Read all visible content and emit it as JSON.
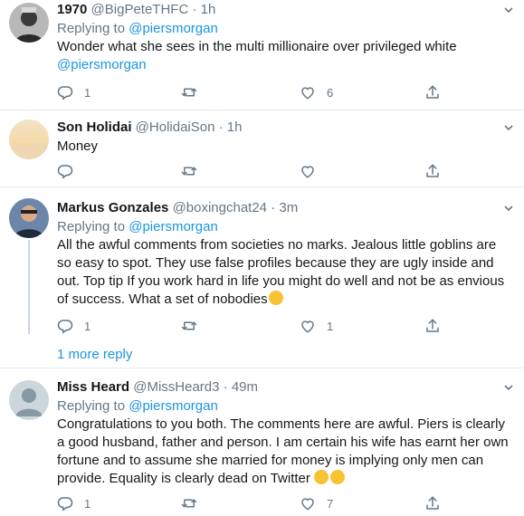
{
  "tweets": [
    {
      "name": "1970",
      "handle": "@BigPeteTHFC",
      "sep": "·",
      "time": "1h",
      "replying_prefix": "Replying to ",
      "replying_to": "@piersmorgan",
      "text": "Wonder what she sees in the multi millionaire over privileged white",
      "text_mention": "@piersmorgan",
      "reply_count": "1",
      "retweet_count": "",
      "like_count": "6"
    },
    {
      "name": "Son Holidai",
      "handle": "@HolidaiSon",
      "sep": "·",
      "time": "1h",
      "text": "Money",
      "reply_count": "",
      "retweet_count": "",
      "like_count": ""
    },
    {
      "name": "Markus Gonzales",
      "handle": "@boxingchat24",
      "sep": "·",
      "time": "3m",
      "replying_prefix": "Replying to ",
      "replying_to": "@piersmorgan",
      "text": "All the awful comments from societies no marks. Jealous little goblins are so easy to spot. They use false profiles because they are ugly inside and out. Top tip If you work hard in life you might do well and not be as envious of success. What a set of nobodies",
      "reply_count": "1",
      "retweet_count": "",
      "like_count": "1"
    },
    {
      "name": "Miss Heard",
      "handle": "@MissHeard3",
      "sep": "·",
      "time": "49m",
      "replying_prefix": "Replying to ",
      "replying_to": "@piersmorgan",
      "text": "Congratulations to you both. The comments here are awful. Piers is clearly a good husband, father and person. I am certain his wife has earnt her own fortune and to assume she married for money is implying only men can provide. Equality is clearly dead on Twitter",
      "reply_count": "1",
      "retweet_count": "",
      "like_count": "7"
    }
  ],
  "more_replies_label": "1 more reply",
  "icons": {
    "reply": "reply-icon",
    "retweet": "retweet-icon",
    "like": "heart-icon",
    "share": "share-icon",
    "caret": "chevron-down-icon"
  },
  "colors": {
    "link": "#1b95e0",
    "muted": "#657786",
    "divider": "#e6ecf0",
    "text": "#14171a"
  }
}
